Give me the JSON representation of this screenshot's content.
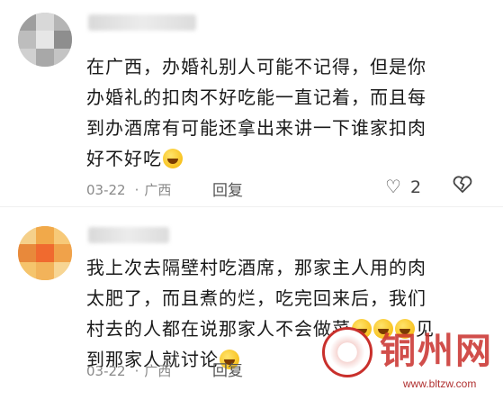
{
  "comments": [
    {
      "text_lines": [
        "在广西，办婚礼别人可能不记得，但是你",
        "办婚礼的扣肉不好吃能一直记着，而且每",
        "到办酒席有可能还拿出来讲一下谁家扣肉",
        "好不好吃"
      ],
      "date": "03-22",
      "location": "广西",
      "reply_label": "回复",
      "like_count": "2"
    },
    {
      "text_lines": [
        "我上次去隔壁村吃酒席，那家主人用的肉",
        "太肥了，而且煮的烂，吃完回来后，我们",
        "村去的人都在说那家人不会做菜",
        "见",
        "到那家人就讨论"
      ],
      "date": "03-22",
      "location": "广西",
      "reply_label": "回复"
    }
  ],
  "icons": {
    "like": "heart-outline-icon",
    "dislike": "broken-heart-icon",
    "emoji": "grinning-sweat-emoji"
  },
  "watermark": {
    "name": "铜州网",
    "url": "www.bltzw.com"
  },
  "colors": {
    "text": "#1a1a1a",
    "meta": "#8a8a8a",
    "watermark": "#c9302c"
  }
}
